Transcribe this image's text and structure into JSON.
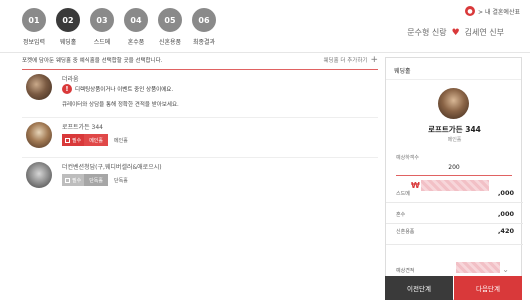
{
  "steps": [
    {
      "num": "01",
      "label": "정보입력"
    },
    {
      "num": "02",
      "label": "웨딩홀"
    },
    {
      "num": "03",
      "label": "스드메"
    },
    {
      "num": "04",
      "label": "혼수품"
    },
    {
      "num": "05",
      "label": "신혼용품"
    },
    {
      "num": "06",
      "label": "최종결과"
    }
  ],
  "header": {
    "breadcrumb": "> 내 결혼예산표",
    "groom": "문수형 신랑",
    "bride": "김세연 신부"
  },
  "main": {
    "instruction": "포켓에 담아둔 웨딩홀 중 예식홀을 선택합할 곳을 선택합니다.",
    "add_more": "웨딩홀 더 추가하기",
    "venues": [
      {
        "name": "더라움",
        "warning": "디렉팅상품이거나 이벤트 중인 상품이에요.",
        "warning_sub": "큐레이터와 상담을 통해 정확한 견적을 받아보세요."
      },
      {
        "name": "로프트가든 344",
        "check_label": "필수",
        "tag": "메인홀",
        "hall": "메인홀"
      },
      {
        "name": "더컨벤션청담(구,웨디버셀러&애로으시)",
        "check_label": "필수",
        "tag": "단독홀",
        "hall": "단독홀"
      }
    ]
  },
  "sidebar": {
    "title": "웨딩홀",
    "venue": "로프트가든 344",
    "hall": "메인홀",
    "guests_label": "예상하객수",
    "guests": "200",
    "currency": "₩",
    "costs": [
      {
        "label": "스드메",
        "value": ",000"
      },
      {
        "label": "혼수",
        "value": ",000"
      },
      {
        "label": "신혼용품",
        "value": ",420"
      }
    ],
    "estimate_label": "예상견적"
  },
  "buttons": {
    "prev": "이전단계",
    "next": "다음단계"
  }
}
